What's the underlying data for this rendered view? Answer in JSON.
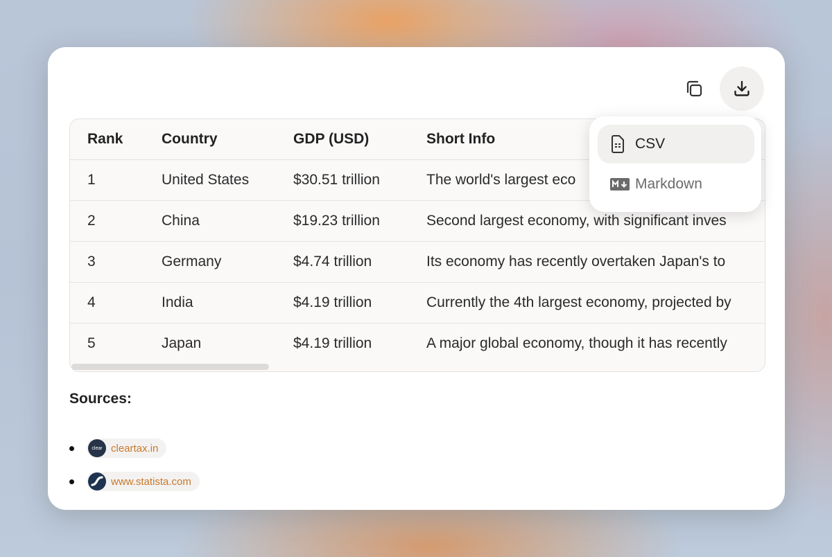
{
  "toolbar": {
    "copy_icon": "copy-icon",
    "download_icon": "download-icon"
  },
  "table": {
    "headers": [
      "Rank",
      "Country",
      "GDP (USD)",
      "Short Info"
    ],
    "rows": [
      [
        "1",
        "United States",
        "$30.51 trillion",
        "The world's largest eco"
      ],
      [
        "2",
        "China",
        "$19.23 trillion",
        "Second largest economy, with significant inves"
      ],
      [
        "3",
        "Germany",
        "$4.74 trillion",
        "Its economy has recently overtaken Japan's to"
      ],
      [
        "4",
        "India",
        "$4.19 trillion",
        "Currently the 4th largest economy, projected by"
      ],
      [
        "5",
        "Japan",
        "$4.19 trillion",
        "A major global economy, though it has recently"
      ]
    ]
  },
  "download_menu": {
    "items": [
      {
        "label": "CSV",
        "icon": "csv-file-icon"
      },
      {
        "label": "Markdown",
        "icon": "markdown-icon"
      }
    ]
  },
  "sources": {
    "title": "Sources:",
    "items": [
      {
        "label": "cleartax.in",
        "favicon_text": "clear"
      },
      {
        "label": "www.statista.com",
        "favicon_text": ""
      }
    ]
  },
  "colors": {
    "link": "#c9782a",
    "card_bg": "#ffffff",
    "menu_active_bg": "#f1f0ef"
  }
}
